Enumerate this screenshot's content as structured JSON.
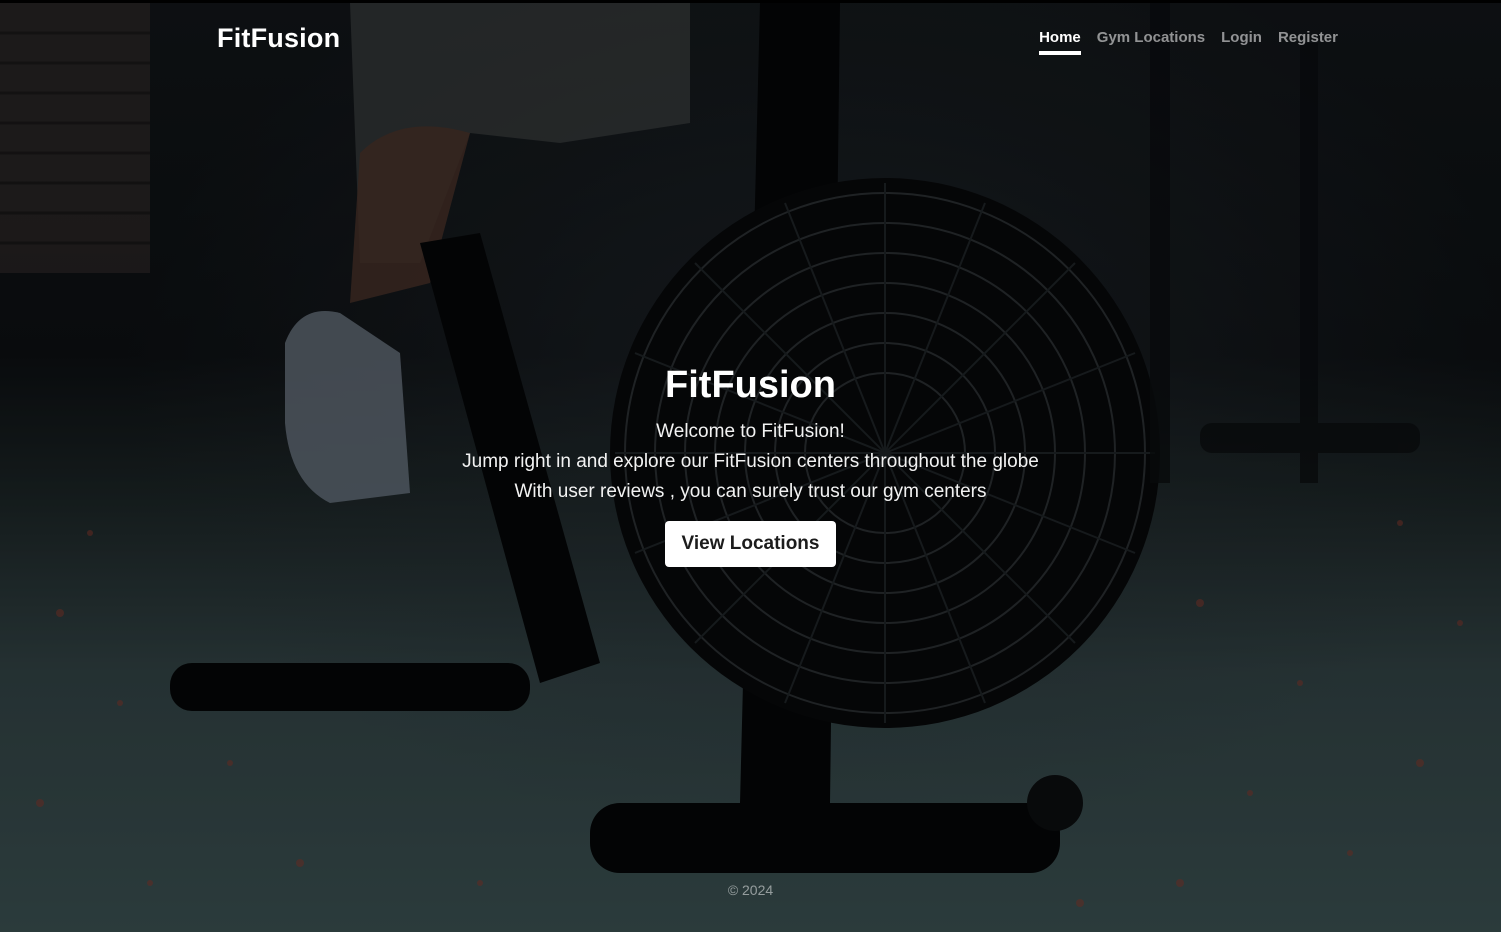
{
  "header": {
    "brand": "FitFusion",
    "nav": {
      "home": "Home",
      "gym_locations": "Gym Locations",
      "login": "Login",
      "register": "Register"
    }
  },
  "hero": {
    "title": "FitFusion",
    "welcome": "Welcome to FitFusion!",
    "line1": "Jump right in and explore our FitFusion centers throughout the globe",
    "line2": "With user reviews , you can surely trust our gym centers",
    "cta_label": "View Locations"
  },
  "footer": {
    "copyright": "© 2024"
  },
  "colors": {
    "text": "#ffffff",
    "nav_inactive": "rgba(255,255,255,0.55)",
    "cta_bg": "#ffffff",
    "cta_text": "#1c1c1c"
  }
}
